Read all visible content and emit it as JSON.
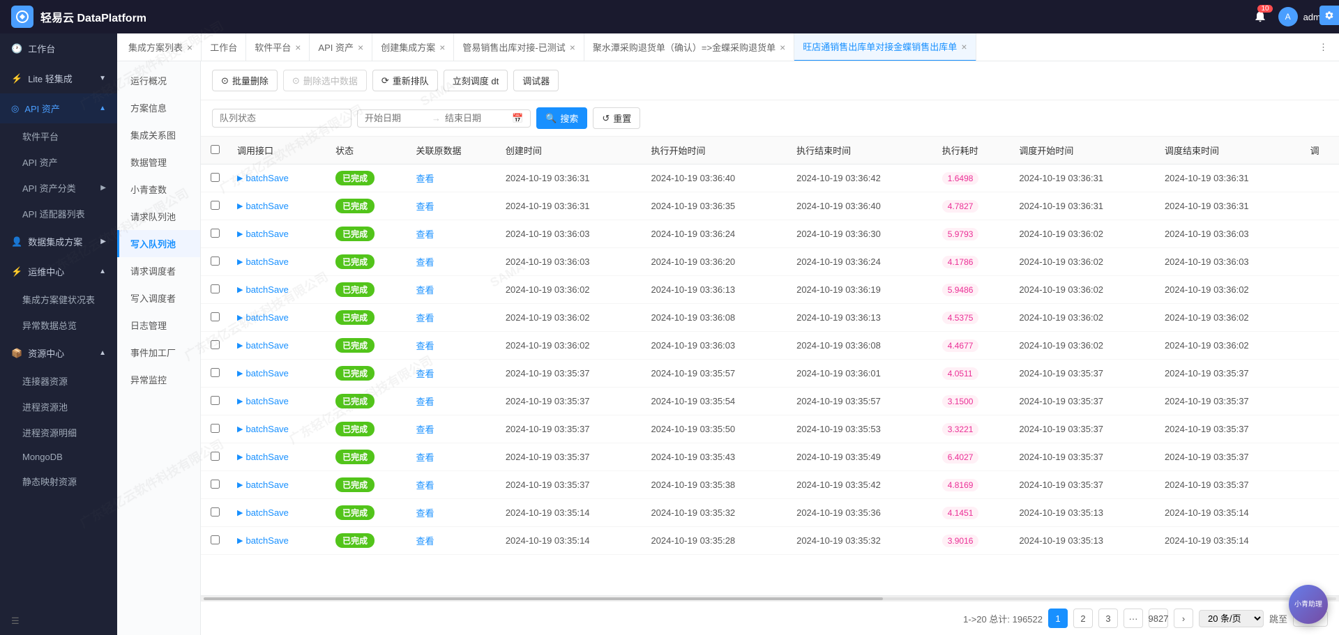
{
  "header": {
    "logo_text": "轻易云 DataPlatform",
    "notification_count": "10",
    "user_name": "admin"
  },
  "tabs": [
    {
      "id": "integration-list",
      "label": "集成方案列表",
      "closable": true,
      "active": false
    },
    {
      "id": "workbench",
      "label": "工作台",
      "closable": false,
      "active": false
    },
    {
      "id": "software-platform",
      "label": "软件平台",
      "closable": true,
      "active": false
    },
    {
      "id": "api-assets",
      "label": "API 资产",
      "closable": true,
      "active": false
    },
    {
      "id": "create-integration",
      "label": "创建集成方案",
      "closable": true,
      "active": false
    },
    {
      "id": "manage-sales-out",
      "label": "管易销售出库对接-已测试",
      "closable": true,
      "active": false
    },
    {
      "id": "juicy-purchase-return",
      "label": "聚水潭采购退货单（确认）=>金蝶采购退货单",
      "closable": true,
      "active": false
    },
    {
      "id": "wang-sales-out",
      "label": "旺店通销售出库单对接金蝶销售出库单",
      "closable": true,
      "active": true
    }
  ],
  "sidebar": {
    "items": [
      {
        "id": "workbench",
        "label": "工作台",
        "icon": "🏠",
        "active": false,
        "expandable": false
      },
      {
        "id": "lite-integration",
        "label": "Lite 轻集成",
        "icon": "⚡",
        "active": false,
        "expandable": true
      },
      {
        "id": "api-assets",
        "label": "API 资产",
        "icon": "◎",
        "active": true,
        "expandable": true
      },
      {
        "id": "software-platform",
        "label": "软件平台",
        "icon": "",
        "sub": true,
        "active": false
      },
      {
        "id": "api-assets-sub",
        "label": "API 资产",
        "icon": "",
        "sub": true,
        "active": false
      },
      {
        "id": "api-classification",
        "label": "API 资产分类",
        "icon": "",
        "sub": true,
        "expandable": true,
        "active": false
      },
      {
        "id": "api-adapter",
        "label": "API 适配器列表",
        "icon": "",
        "sub": true,
        "active": false
      },
      {
        "id": "data-integration",
        "label": "数据集成方案",
        "icon": "👤",
        "active": false,
        "expandable": true
      },
      {
        "id": "operation-center",
        "label": "运维中心",
        "icon": "⚡",
        "active": false,
        "expandable": true
      },
      {
        "id": "integration-health",
        "label": "集成方案健状况表",
        "icon": "",
        "sub": true,
        "active": false
      },
      {
        "id": "exception-data",
        "label": "异常数据总览",
        "icon": "",
        "sub": true,
        "active": false
      },
      {
        "id": "resource-center",
        "label": "资源中心",
        "icon": "📦",
        "active": false,
        "expandable": true
      },
      {
        "id": "connector-resources",
        "label": "连接器资源",
        "icon": "",
        "sub": true,
        "active": false
      },
      {
        "id": "process-pool",
        "label": "进程资源池",
        "icon": "",
        "sub": true,
        "active": false
      },
      {
        "id": "process-detail",
        "label": "进程资源明细",
        "icon": "",
        "sub": true,
        "active": false
      },
      {
        "id": "mongodb",
        "label": "MongoDB",
        "icon": "",
        "sub": true,
        "active": false
      },
      {
        "id": "static-mapping",
        "label": "静态映射资源",
        "icon": "",
        "sub": true,
        "active": false
      }
    ],
    "bottom_icon": "☰"
  },
  "page_nav": {
    "items": [
      {
        "id": "run-overview",
        "label": "运行概况",
        "active": false
      },
      {
        "id": "solution-info",
        "label": "方案信息",
        "active": false
      },
      {
        "id": "integration-diagram",
        "label": "集成关系图",
        "active": false
      },
      {
        "id": "data-management",
        "label": "数据管理",
        "active": false
      },
      {
        "id": "xiao-qing-count",
        "label": "小青查数",
        "active": false
      },
      {
        "id": "request-queue",
        "label": "请求队列池",
        "active": false
      },
      {
        "id": "write-queue",
        "label": "写入队列池",
        "active": true
      },
      {
        "id": "request-scheduler",
        "label": "请求调度者",
        "active": false
      },
      {
        "id": "write-scheduler",
        "label": "写入调度者",
        "active": false
      },
      {
        "id": "log-management",
        "label": "日志管理",
        "active": false
      },
      {
        "id": "event-factory",
        "label": "事件加工厂",
        "active": false
      },
      {
        "id": "exception-monitor",
        "label": "异常监控",
        "active": false
      }
    ]
  },
  "toolbar": {
    "batch_delete_label": "批量删除",
    "delete_selected_label": "删除选中数据",
    "reorder_label": "重新排队",
    "schedule_label": "立刻调度 dt",
    "debugger_label": "调试器"
  },
  "filter": {
    "status_placeholder": "队列状态",
    "start_date_placeholder": "开始日期",
    "end_date_placeholder": "结束日期",
    "search_label": "搜索",
    "reset_label": "重置"
  },
  "table": {
    "columns": [
      {
        "id": "checkbox",
        "label": ""
      },
      {
        "id": "interface",
        "label": "调用接口"
      },
      {
        "id": "status",
        "label": "状态"
      },
      {
        "id": "related-data",
        "label": "关联原数据"
      },
      {
        "id": "created-time",
        "label": "创建时间"
      },
      {
        "id": "exec-start",
        "label": "执行开始时间"
      },
      {
        "id": "exec-end",
        "label": "执行结束时间"
      },
      {
        "id": "exec-duration",
        "label": "执行耗时"
      },
      {
        "id": "sched-start",
        "label": "调度开始时间"
      },
      {
        "id": "sched-end",
        "label": "调度结束时间"
      },
      {
        "id": "sched-col",
        "label": "调"
      }
    ],
    "rows": [
      {
        "interface": "batchSave",
        "status": "已完成",
        "related_data": "查看",
        "created": "2024-10-19 03:36:31",
        "exec_start": "2024-10-19 03:36:40",
        "exec_end": "2024-10-19 03:36:42",
        "duration": "1.6498",
        "sched_start": "2024-10-19 03:36:31",
        "sched_end": "2024-10-19 03:36:31"
      },
      {
        "interface": "batchSave",
        "status": "已完成",
        "related_data": "查看",
        "created": "2024-10-19 03:36:31",
        "exec_start": "2024-10-19 03:36:35",
        "exec_end": "2024-10-19 03:36:40",
        "duration": "4.7827",
        "sched_start": "2024-10-19 03:36:31",
        "sched_end": "2024-10-19 03:36:31"
      },
      {
        "interface": "batchSave",
        "status": "已完成",
        "related_data": "查看",
        "created": "2024-10-19 03:36:03",
        "exec_start": "2024-10-19 03:36:24",
        "exec_end": "2024-10-19 03:36:30",
        "duration": "5.9793",
        "sched_start": "2024-10-19 03:36:02",
        "sched_end": "2024-10-19 03:36:03"
      },
      {
        "interface": "batchSave",
        "status": "已完成",
        "related_data": "查看",
        "created": "2024-10-19 03:36:03",
        "exec_start": "2024-10-19 03:36:20",
        "exec_end": "2024-10-19 03:36:24",
        "duration": "4.1786",
        "sched_start": "2024-10-19 03:36:02",
        "sched_end": "2024-10-19 03:36:03"
      },
      {
        "interface": "batchSave",
        "status": "已完成",
        "related_data": "查看",
        "created": "2024-10-19 03:36:02",
        "exec_start": "2024-10-19 03:36:13",
        "exec_end": "2024-10-19 03:36:19",
        "duration": "5.9486",
        "sched_start": "2024-10-19 03:36:02",
        "sched_end": "2024-10-19 03:36:02"
      },
      {
        "interface": "batchSave",
        "status": "已完成",
        "related_data": "查看",
        "created": "2024-10-19 03:36:02",
        "exec_start": "2024-10-19 03:36:08",
        "exec_end": "2024-10-19 03:36:13",
        "duration": "4.5375",
        "sched_start": "2024-10-19 03:36:02",
        "sched_end": "2024-10-19 03:36:02"
      },
      {
        "interface": "batchSave",
        "status": "已完成",
        "related_data": "查看",
        "created": "2024-10-19 03:36:02",
        "exec_start": "2024-10-19 03:36:03",
        "exec_end": "2024-10-19 03:36:08",
        "duration": "4.4677",
        "sched_start": "2024-10-19 03:36:02",
        "sched_end": "2024-10-19 03:36:02"
      },
      {
        "interface": "batchSave",
        "status": "已完成",
        "related_data": "查看",
        "created": "2024-10-19 03:35:37",
        "exec_start": "2024-10-19 03:35:57",
        "exec_end": "2024-10-19 03:36:01",
        "duration": "4.0511",
        "sched_start": "2024-10-19 03:35:37",
        "sched_end": "2024-10-19 03:35:37"
      },
      {
        "interface": "batchSave",
        "status": "已完成",
        "related_data": "查看",
        "created": "2024-10-19 03:35:37",
        "exec_start": "2024-10-19 03:35:54",
        "exec_end": "2024-10-19 03:35:57",
        "duration": "3.1500",
        "sched_start": "2024-10-19 03:35:37",
        "sched_end": "2024-10-19 03:35:37"
      },
      {
        "interface": "batchSave",
        "status": "已完成",
        "related_data": "查看",
        "created": "2024-10-19 03:35:37",
        "exec_start": "2024-10-19 03:35:50",
        "exec_end": "2024-10-19 03:35:53",
        "duration": "3.3221",
        "sched_start": "2024-10-19 03:35:37",
        "sched_end": "2024-10-19 03:35:37"
      },
      {
        "interface": "batchSave",
        "status": "已完成",
        "related_data": "查看",
        "created": "2024-10-19 03:35:37",
        "exec_start": "2024-10-19 03:35:43",
        "exec_end": "2024-10-19 03:35:49",
        "duration": "6.4027",
        "sched_start": "2024-10-19 03:35:37",
        "sched_end": "2024-10-19 03:35:37"
      },
      {
        "interface": "batchSave",
        "status": "已完成",
        "related_data": "查看",
        "created": "2024-10-19 03:35:37",
        "exec_start": "2024-10-19 03:35:38",
        "exec_end": "2024-10-19 03:35:42",
        "duration": "4.8169",
        "sched_start": "2024-10-19 03:35:37",
        "sched_end": "2024-10-19 03:35:37"
      },
      {
        "interface": "batchSave",
        "status": "已完成",
        "related_data": "查看",
        "created": "2024-10-19 03:35:14",
        "exec_start": "2024-10-19 03:35:32",
        "exec_end": "2024-10-19 03:35:36",
        "duration": "4.1451",
        "sched_start": "2024-10-19 03:35:13",
        "sched_end": "2024-10-19 03:35:14"
      },
      {
        "interface": "batchSave",
        "status": "已完成",
        "related_data": "查看",
        "created": "2024-10-19 03:35:14",
        "exec_start": "2024-10-19 03:35:28",
        "exec_end": "2024-10-19 03:35:32",
        "duration": "3.9016",
        "sched_start": "2024-10-19 03:35:13",
        "sched_end": "2024-10-19 03:35:14"
      }
    ]
  },
  "pagination": {
    "info": "1->20 总计: 196522",
    "pages": [
      "1",
      "2",
      "3",
      "...",
      "9827"
    ],
    "page_size": "20 条/页",
    "goto_label": "跳至"
  },
  "assistant": {
    "label": "小青助理"
  },
  "colors": {
    "primary": "#1890ff",
    "success": "#52c41a",
    "pink": "#eb2f96",
    "pink_bg": "#fff0f6",
    "header_bg": "#1a1a2e",
    "sidebar_bg": "#1e2235"
  }
}
